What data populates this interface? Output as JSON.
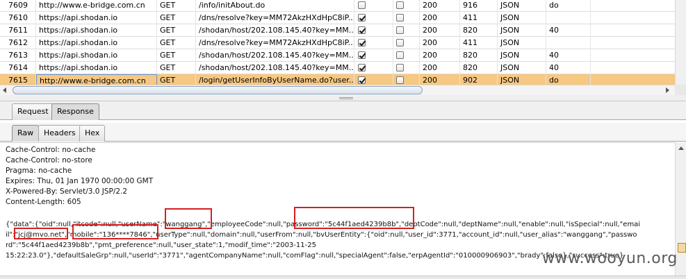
{
  "history": {
    "rows": [
      {
        "id": "7609",
        "host": "http://www.e-bridge.com.cn",
        "method": "GET",
        "url": "/info/initAbout.do",
        "params": false,
        "edited": false,
        "status": "200",
        "length": "916",
        "mime": "JSON",
        "extension": "do",
        "selected": false
      },
      {
        "id": "7610",
        "host": "https://api.shodan.io",
        "method": "GET",
        "url": "/dns/resolve?key=MM72AkzHXdHpC8iP...",
        "params": true,
        "edited": false,
        "status": "200",
        "length": "411",
        "mime": "JSON",
        "extension": "",
        "selected": false
      },
      {
        "id": "7611",
        "host": "https://api.shodan.io",
        "method": "GET",
        "url": "/shodan/host/202.108.145.40?key=MM...",
        "params": true,
        "edited": false,
        "status": "200",
        "length": "820",
        "mime": "JSON",
        "extension": "40",
        "selected": false
      },
      {
        "id": "7612",
        "host": "https://api.shodan.io",
        "method": "GET",
        "url": "/dns/resolve?key=MM72AkzHXdHpC8iP...",
        "params": true,
        "edited": false,
        "status": "200",
        "length": "411",
        "mime": "JSON",
        "extension": "",
        "selected": false
      },
      {
        "id": "7613",
        "host": "https://api.shodan.io",
        "method": "GET",
        "url": "/shodan/host/202.108.145.40?key=MM...",
        "params": true,
        "edited": false,
        "status": "200",
        "length": "820",
        "mime": "JSON",
        "extension": "40",
        "selected": false
      },
      {
        "id": "7614",
        "host": "https://api.shodan.io",
        "method": "GET",
        "url": "/shodan/host/202.108.145.40?key=MM...",
        "params": true,
        "edited": false,
        "status": "200",
        "length": "820",
        "mime": "JSON",
        "extension": "40",
        "selected": false
      },
      {
        "id": "7615",
        "host": "http://www.e-bridge.com.cn",
        "method": "GET",
        "url": "/login/getUserInfoByUserName.do?user...",
        "params": true,
        "edited": false,
        "status": "200",
        "length": "902",
        "mime": "JSON",
        "extension": "do",
        "selected": true
      }
    ]
  },
  "message_tabs": {
    "request": "Request",
    "response": "Response",
    "active": "response"
  },
  "view_tabs": {
    "raw": "Raw",
    "headers": "Headers",
    "hex": "Hex",
    "active": "raw"
  },
  "response": {
    "headers": [
      "Cache-Control: no-cache",
      "Cache-Control: no-store",
      "Pragma: no-cache",
      "Expires: Thu, 01 Jan 1970 00:00:00 GMT",
      "X-Powered-By: Servlet/3.0 JSP/2.2",
      "Content-Length: 605"
    ],
    "body_lines": [
      "{\"data\":{\"oid\":null,\"itcode\":null,\"userName\":\"wanggang\",\"employeeCode\":null,\"password\":\"5c44f1aed4239b8b\",\"deptCode\":null,\"deptName\":null,\"enable\":null,\"isSpecial\":null,\"emai",
      "il\":\"jcj@mvo.net\",\"mobile\":\"136****7846\",\"userType\":null,\"domain\":null,\"userFrom\":null,\"bvUserEntity\":{\"oid\":null,\"user_id\":3771,\"account_id\":null,\"user_alias\":\"wanggang\",\"passwo",
      "rd\":\"5c44f1aed4239b8b\",\"pmt_preference\":null,\"user_state\":1,\"modif_time\":\"2003-11-25",
      "15:22:23.0\"},\"defaultSaleGrp\":null,\"userId\":\"3771\",\"agentCompanyName\":null,\"comFlag\":null,\"specialAgent\":false,\"erpAgentId\":\"010000906903\",\"brady\":false},\"success\":true}"
    ]
  },
  "watermark": "www.wooyun.org",
  "colors": {
    "selected_row": "#f7c882",
    "highlight_box": "#d42020"
  }
}
